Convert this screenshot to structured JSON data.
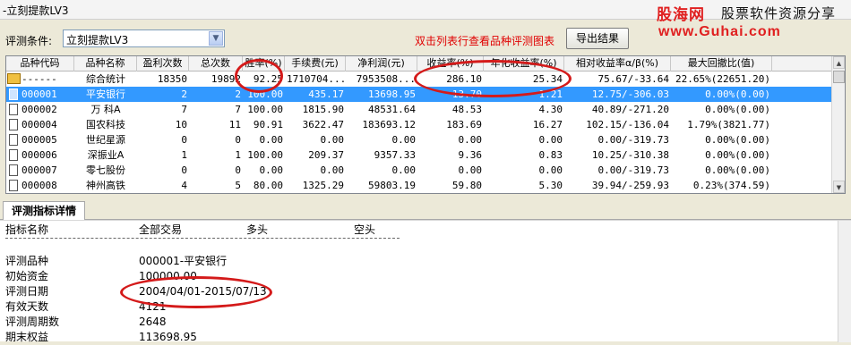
{
  "window": {
    "title": "-立刻提款LV3"
  },
  "brand": {
    "name": "股海网",
    "tagline": "股票软件资源分享",
    "url": "www.Guhai.com"
  },
  "toolbar": {
    "condition_label": "评测条件:",
    "condition_value": "立刻提款LV3",
    "hint": "双击列表行查看品种评测图表",
    "export_label": "导出结果"
  },
  "grid": {
    "headers": [
      "品种代码",
      "品种名称",
      "盈利次数",
      "总次数",
      "胜率(%)",
      "手续费(元)",
      "净利润(元)",
      "收益率(%)",
      "年化收益率(%)",
      "相对收益率α/β(%)",
      "最大回撤比(值)"
    ],
    "rows": [
      {
        "code": "------",
        "name": "综合统计",
        "wins": "18350",
        "total": "19892",
        "win_rate": "92.25",
        "fee": "1710704...",
        "profit": "7953508...",
        "return": "286.10",
        "annual": "25.34",
        "relative": "75.67/-33.64",
        "drawdown": "22.65%(22651.20)",
        "icon": "summary",
        "selected": false
      },
      {
        "code": "000001",
        "name": "平安银行",
        "wins": "2",
        "total": "2",
        "win_rate": "100.00",
        "fee": "435.17",
        "profit": "13698.95",
        "return": "13.70",
        "annual": "1.21",
        "relative": "12.75/-306.03",
        "drawdown": "0.00%(0.00)",
        "icon": "doc",
        "selected": true
      },
      {
        "code": "000002",
        "name": "万  科A",
        "wins": "7",
        "total": "7",
        "win_rate": "100.00",
        "fee": "1815.90",
        "profit": "48531.64",
        "return": "48.53",
        "annual": "4.30",
        "relative": "40.89/-271.20",
        "drawdown": "0.00%(0.00)",
        "icon": "doc",
        "selected": false
      },
      {
        "code": "000004",
        "name": "国农科技",
        "wins": "10",
        "total": "11",
        "win_rate": "90.91",
        "fee": "3622.47",
        "profit": "183693.12",
        "return": "183.69",
        "annual": "16.27",
        "relative": "102.15/-136.04",
        "drawdown": "1.79%(3821.77)",
        "icon": "doc",
        "selected": false
      },
      {
        "code": "000005",
        "name": "世纪星源",
        "wins": "0",
        "total": "0",
        "win_rate": "0.00",
        "fee": "0.00",
        "profit": "0.00",
        "return": "0.00",
        "annual": "0.00",
        "relative": "0.00/-319.73",
        "drawdown": "0.00%(0.00)",
        "icon": "doc",
        "selected": false
      },
      {
        "code": "000006",
        "name": "深振业A",
        "wins": "1",
        "total": "1",
        "win_rate": "100.00",
        "fee": "209.37",
        "profit": "9357.33",
        "return": "9.36",
        "annual": "0.83",
        "relative": "10.25/-310.38",
        "drawdown": "0.00%(0.00)",
        "icon": "doc",
        "selected": false
      },
      {
        "code": "000007",
        "name": "零七股份",
        "wins": "0",
        "total": "0",
        "win_rate": "0.00",
        "fee": "0.00",
        "profit": "0.00",
        "return": "0.00",
        "annual": "0.00",
        "relative": "0.00/-319.73",
        "drawdown": "0.00%(0.00)",
        "icon": "doc",
        "selected": false
      },
      {
        "code": "000008",
        "name": "神州高铁",
        "wins": "4",
        "total": "5",
        "win_rate": "80.00",
        "fee": "1325.29",
        "profit": "59803.19",
        "return": "59.80",
        "annual": "5.30",
        "relative": "39.94/-259.93",
        "drawdown": "0.23%(374.59)",
        "icon": "doc",
        "selected": false
      }
    ]
  },
  "detail": {
    "tab_label": "评测指标详情",
    "header": {
      "name": "指标名称",
      "all": "全部交易",
      "long": "多头",
      "short": "空头"
    },
    "rows": [
      {
        "label": "评测品种",
        "value": "000001-平安银行"
      },
      {
        "label": "初始资金",
        "value": "100000.00"
      },
      {
        "label": "评测日期",
        "value": "2004/04/01-2015/07/13"
      },
      {
        "label": "有效天数",
        "value": "4121"
      },
      {
        "label": "评测周期数",
        "value": "2648"
      },
      {
        "label": "期末权益",
        "value": "113698.95"
      }
    ]
  },
  "colors": {
    "selection": "#3399ff",
    "highlight_marks": "#d41a1a",
    "hint_text": "#e00000"
  },
  "icons": {
    "dropdown": "chevron-down-icon",
    "summary_row": "summary-folder-icon",
    "data_row": "document-icon"
  }
}
